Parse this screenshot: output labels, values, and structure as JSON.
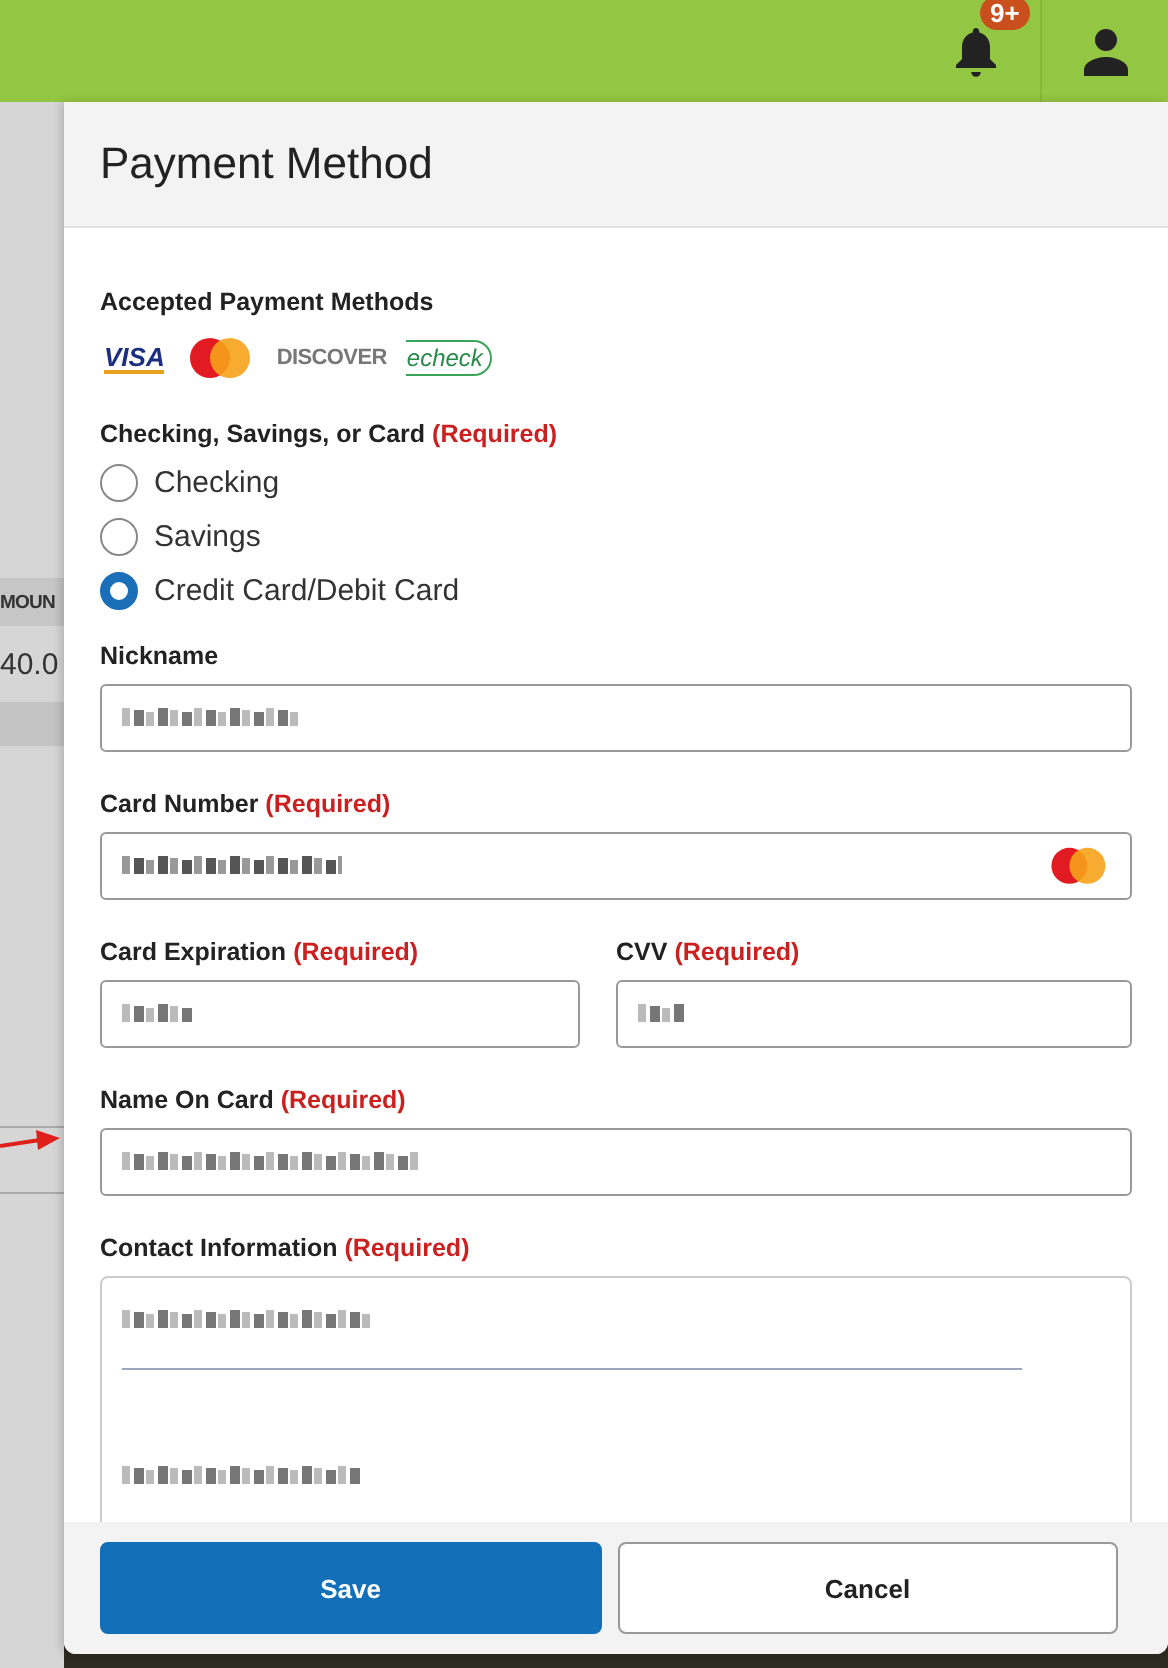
{
  "top_bar": {
    "notification_badge": "9+"
  },
  "background_table": {
    "column_header": "MOUN",
    "cell": "40.0"
  },
  "panel": {
    "title": "Payment Method",
    "accepted_label": "Accepted Payment Methods",
    "payment_logos": [
      {
        "kind": "visa",
        "label": "VISA"
      },
      {
        "kind": "mastercard"
      },
      {
        "kind": "discover",
        "label": "DISCOVER"
      },
      {
        "kind": "echeck",
        "label": "echeck"
      }
    ],
    "account_type": {
      "label": "Checking, Savings, or Card",
      "required": "(Required)",
      "options": [
        {
          "label": "Checking",
          "selected": false
        },
        {
          "label": "Savings",
          "selected": false
        },
        {
          "label": "Credit Card/Debit Card",
          "selected": true
        }
      ]
    },
    "fields": [
      {
        "kind": "text",
        "label": "Nickname",
        "card_icon": false
      },
      {
        "kind": "text",
        "label": "Card Number",
        "required": "(Required)",
        "card_icon": true
      },
      {
        "kind": "pair",
        "items": [
          {
            "label": "Card Expiration",
            "required": "(Required)"
          },
          {
            "label": "CVV",
            "required": "(Required)"
          }
        ]
      },
      {
        "kind": "text",
        "label": "Name On Card",
        "required": "(Required)",
        "card_icon": false,
        "annotated": true
      },
      {
        "kind": "contact",
        "label": "Contact Information",
        "required": "(Required)"
      }
    ],
    "buttons": [
      {
        "label": "Save",
        "kind": "primary"
      },
      {
        "label": "Cancel",
        "kind": "secondary"
      }
    ]
  }
}
